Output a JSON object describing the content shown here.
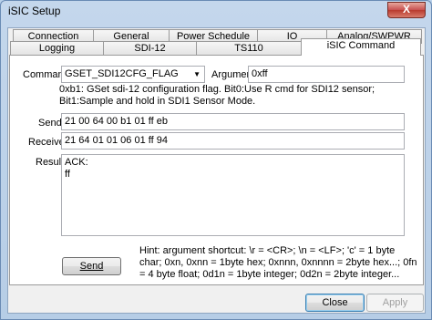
{
  "window": {
    "title": "iSIC Setup",
    "close_glyph": "X"
  },
  "tabs_row1": [
    "Connection",
    "General",
    "Power Schedule",
    "IO",
    "Analog/SWPWR"
  ],
  "tabs_row2": [
    "Logging",
    "SDI-12",
    "TS110",
    "iSIC Command"
  ],
  "active_tab": "iSIC Command",
  "form": {
    "command_label": "Command",
    "command_value": "GSET_SDI12CFG_FLAG",
    "argument_label": "Argument",
    "argument_value": "0xff",
    "description": "0xb1: GSet sdi-12 configuration flag. Bit0:Use R cmd for SDI12 sensor; Bit1:Sample and hold in SDI1 Sensor Mode.",
    "send_label": "Send",
    "send_value": "21 00 64 00 b1 01 ff eb",
    "receive_label": "Receive",
    "receive_value": "21 64 01 01 06 01 ff 94",
    "result_label": "Result",
    "result_value": "ACK:\nff",
    "send_button": "Send",
    "hint": "Hint: argument shortcut: \\r = <CR>; \\n = <LF>; 'c' = 1 byte char; 0xn, 0xnn = 1byte hex; 0xnnn, 0xnnnn = 2byte hex...; 0fn = 4 byte float; 0d1n = 1byte integer; 0d2n = 2byte integer..."
  },
  "footer": {
    "close_button": "Close",
    "apply_button": "Apply"
  }
}
